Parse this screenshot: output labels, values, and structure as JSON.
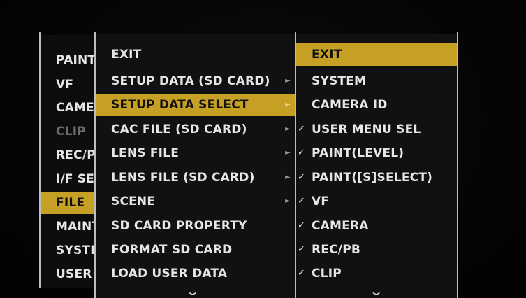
{
  "left_menu": {
    "items": [
      {
        "label": "PAINT",
        "state": "normal"
      },
      {
        "label": "VF",
        "state": "normal"
      },
      {
        "label": "CAMERA",
        "state": "normal"
      },
      {
        "label": "CLIP",
        "state": "disabled"
      },
      {
        "label": "REC/PB",
        "state": "normal"
      },
      {
        "label": "I/F SETUP",
        "state": "normal"
      },
      {
        "label": "FILE",
        "state": "selected"
      },
      {
        "label": "MAINTENANCE",
        "state": "normal"
      },
      {
        "label": "SYSTEM",
        "state": "normal"
      },
      {
        "label": "USER",
        "state": "normal"
      }
    ]
  },
  "file_menu": {
    "items": [
      {
        "label": "EXIT",
        "submenu": false,
        "selected": false
      },
      {
        "label": "SETUP DATA (SD CARD)",
        "submenu": true,
        "selected": false
      },
      {
        "label": "SETUP DATA SELECT",
        "submenu": true,
        "selected": true
      },
      {
        "label": "CAC FILE (SD CARD)",
        "submenu": true,
        "selected": false
      },
      {
        "label": "LENS FILE",
        "submenu": true,
        "selected": false
      },
      {
        "label": "LENS FILE (SD CARD)",
        "submenu": true,
        "selected": false
      },
      {
        "label": "SCENE",
        "submenu": true,
        "selected": false
      },
      {
        "label": "SD CARD PROPERTY",
        "submenu": false,
        "selected": false
      },
      {
        "label": "FORMAT SD CARD",
        "submenu": false,
        "selected": false
      },
      {
        "label": "LOAD USER DATA",
        "submenu": false,
        "selected": false
      }
    ],
    "more_icon": "chevron-down-icon"
  },
  "setup_select_menu": {
    "items": [
      {
        "label": "EXIT",
        "checked": false,
        "selected": true
      },
      {
        "label": "SYSTEM",
        "checked": false,
        "selected": false
      },
      {
        "label": "CAMERA ID",
        "checked": false,
        "selected": false
      },
      {
        "label": "USER MENU SEL",
        "checked": true,
        "selected": false
      },
      {
        "label": "PAINT(LEVEL)",
        "checked": true,
        "selected": false
      },
      {
        "label": "PAINT([S]SELECT)",
        "checked": true,
        "selected": false
      },
      {
        "label": "VF",
        "checked": true,
        "selected": false
      },
      {
        "label": "CAMERA",
        "checked": true,
        "selected": false
      },
      {
        "label": "REC/PB",
        "checked": true,
        "selected": false
      },
      {
        "label": "CLIP",
        "checked": true,
        "selected": false
      }
    ],
    "more_icon": "chevron-down-icon"
  },
  "glyphs": {
    "submenu_arrow": "►",
    "check": "✓",
    "more": "⌄"
  },
  "colors": {
    "highlight": "#c6a024",
    "text": "#e6e6e6",
    "disabled": "#6c6c6c",
    "background": "#111111"
  }
}
